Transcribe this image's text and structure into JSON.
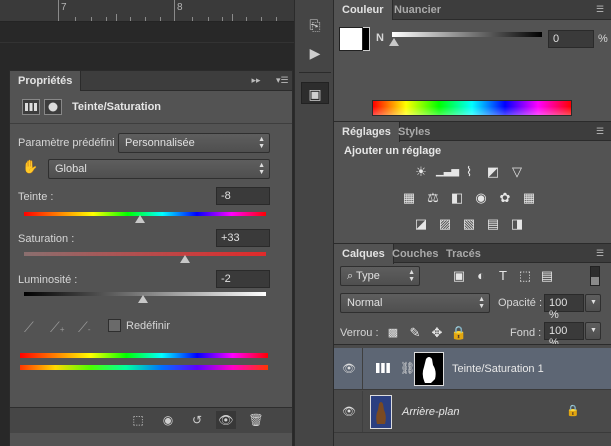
{
  "ruler": {
    "marks": [
      "7",
      "8"
    ]
  },
  "properties": {
    "tab": "Propriétés",
    "adjustment_title": "Teinte/Saturation",
    "preset_label": "Paramètre prédéfini :",
    "preset_value": "Personnalisée",
    "channel_value": "Global",
    "hue_label": "Teinte :",
    "hue_value": "-8",
    "hue_level": -8,
    "saturation_label": "Saturation :",
    "saturation_value": "+33",
    "saturation_level": 33,
    "lightness_label": "Luminosité :",
    "lightness_value": "-2",
    "lightness_level": -2,
    "colorize_label": "Redéfinir"
  },
  "color_panel": {
    "tab_color": "Couleur",
    "tab_swatches": "Nuancier",
    "channel_label": "N",
    "value": "0",
    "unit": "%"
  },
  "adjustments": {
    "tab_adjustments": "Réglages",
    "tab_styles": "Styles",
    "heading": "Ajouter un réglage"
  },
  "layers": {
    "tab_layers": "Calques",
    "tab_channels": "Couches",
    "tab_paths": "Tracés",
    "filter_type": "Type",
    "blend_mode": "Normal",
    "opacity_label": "Opacité :",
    "opacity_value": "100 %",
    "lock_label": "Verrou :",
    "fill_label": "Fond :",
    "fill_value": "100 %",
    "items": [
      {
        "name": "Teinte/Saturation 1"
      },
      {
        "name": "Arrière-plan"
      }
    ]
  }
}
